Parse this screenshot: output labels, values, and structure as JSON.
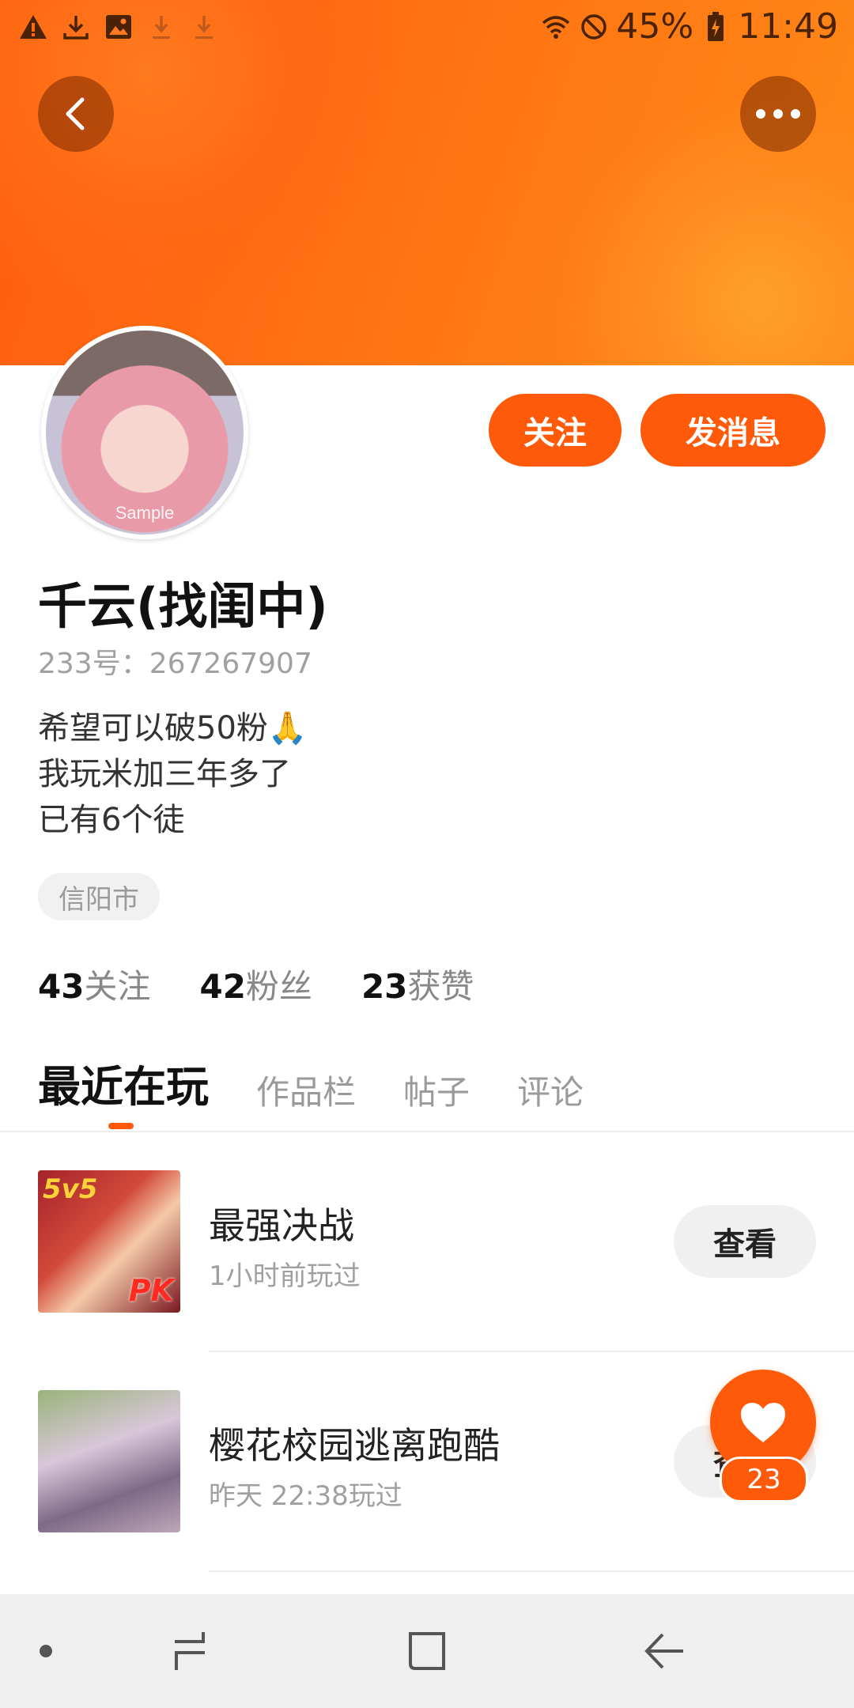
{
  "status_bar": {
    "battery": "45%",
    "time": "11:49",
    "left_icons": [
      "warning-icon",
      "download-icon",
      "image-icon",
      "download-icon",
      "download-icon"
    ],
    "right_icons": [
      "wifi-icon",
      "do-not-disturb-icon",
      "battery-charging-icon"
    ]
  },
  "header": {
    "back_icon": "chevron-left-icon",
    "more_icon": "more-icon"
  },
  "profile": {
    "avatar_watermark": "Sample",
    "follow_label": "关注",
    "message_label": "发消息",
    "name": "千云(找闺中)",
    "user_id": "233号：267267907",
    "bio": [
      "希望可以破50粉🙏",
      "我玩米加三年多了",
      "已有6个徒"
    ],
    "location": "信阳市"
  },
  "stats": [
    {
      "num": "43",
      "label": "关注"
    },
    {
      "num": "42",
      "label": "粉丝"
    },
    {
      "num": "23",
      "label": "获赞"
    }
  ],
  "tabs": [
    {
      "label": "最近在玩",
      "active": true
    },
    {
      "label": "作品栏",
      "active": false
    },
    {
      "label": "帖子",
      "active": false
    },
    {
      "label": "评论",
      "active": false
    }
  ],
  "games": [
    {
      "title": "最强决战",
      "sub": "1小时前玩过",
      "button": "查看",
      "thumb_tag_a": "5v5",
      "thumb_tag_b": "PK"
    },
    {
      "title": "樱花校园逃离跑酷",
      "sub": "昨天 22:38玩过",
      "button": "查看"
    }
  ],
  "like_fab": {
    "count": "23",
    "icon": "heart-icon"
  },
  "colors": {
    "accent": "#ff5a0a",
    "banner": "#ff7212"
  }
}
